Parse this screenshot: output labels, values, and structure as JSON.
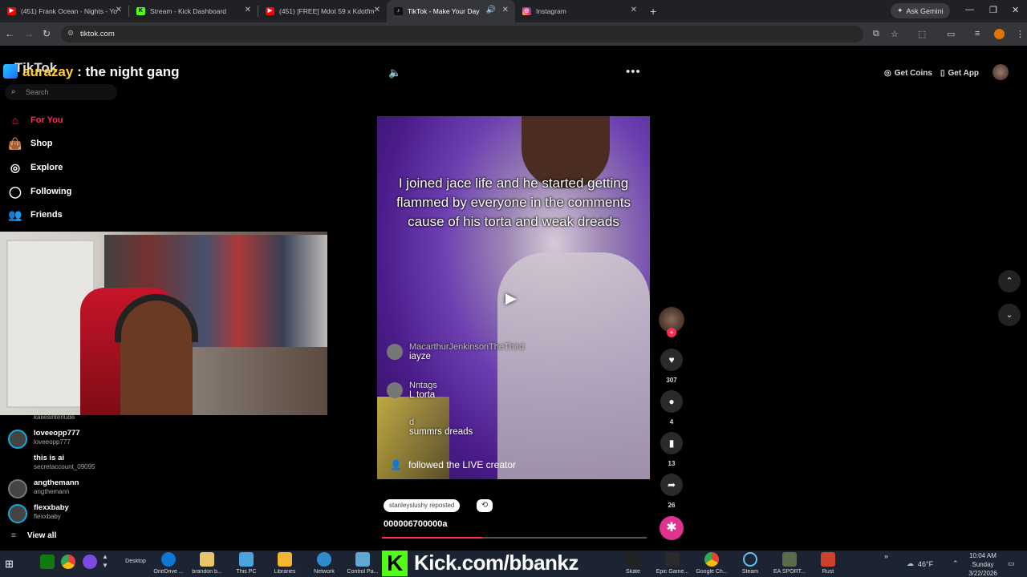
{
  "browser": {
    "tabs": [
      {
        "title": "(451) Frank Ocean - Nights - Yo",
        "icon": "youtube-icon",
        "color": "#ff0000",
        "active": false
      },
      {
        "title": "Stream - Kick Dashboard",
        "icon": "kick-icon",
        "color": "#53fc18",
        "active": false
      },
      {
        "title": "(451) [FREE] Mdot 59 x Kdotfm",
        "icon": "youtube-icon",
        "color": "#ff0000",
        "active": false
      },
      {
        "title": "TikTok - Make Your Day",
        "icon": "tiktok-icon",
        "color": "#000000",
        "active": true
      },
      {
        "title": "Instagram",
        "icon": "instagram-icon",
        "color": "#e1306c",
        "active": false
      }
    ],
    "gemini_label": "Ask Gemini",
    "url": "tiktok.com"
  },
  "tiktok": {
    "logo": "TikTok",
    "overlay_user": "aurazay",
    "overlay_text": ": the night gang",
    "search_placeholder": "Search",
    "nav": [
      {
        "label": "For You",
        "icon": "home-icon",
        "active": true
      },
      {
        "label": "Shop",
        "icon": "shopping-bag-icon",
        "active": false
      },
      {
        "label": "Explore",
        "icon": "compass-icon",
        "active": false
      },
      {
        "label": "Following",
        "icon": "following-icon",
        "active": false
      },
      {
        "label": "Friends",
        "icon": "friends-icon",
        "active": false
      }
    ],
    "following_list": [
      {
        "name": "",
        "username": "kaliesinterlude"
      },
      {
        "name": "loveeopp777",
        "username": "loveeopp777"
      },
      {
        "name": "this is ai",
        "username": "secretaccount_09095"
      },
      {
        "name": "angthemann",
        "username": "angthemann"
      },
      {
        "name": "flexxbaby",
        "username": "flexxbaby"
      }
    ],
    "view_all": "View all",
    "get_coins": "Get Coins",
    "get_app": "Get App",
    "video": {
      "caption": "I joined jace life and he started getting flammed by everyone in the comments cause of his torta and weak dreads",
      "comments": [
        {
          "user": "MacarthurJenkinsonTheThird",
          "text": "iayze"
        },
        {
          "user": "Nntags",
          "text": "L torta"
        },
        {
          "user": "d",
          "text": "summrs dreads"
        }
      ],
      "follow_notice": "followed the LIVE creator",
      "reposted_by": "stanleyslushy reposted",
      "title": "000006700000a",
      "progress": 0.38
    },
    "actions": {
      "likes": "307",
      "comments": "4",
      "saves": "13",
      "shares": "26"
    }
  },
  "taskbar": {
    "items": [
      {
        "label": "Desktop"
      },
      {
        "label": "OneDrive ..."
      },
      {
        "label": "brandon b..."
      },
      {
        "label": "This PC"
      },
      {
        "label": "Libraries"
      },
      {
        "label": "Network"
      },
      {
        "label": "Control Pa..."
      },
      {
        "label": "Skate"
      },
      {
        "label": "Epic Game..."
      },
      {
        "label": "Google Ch..."
      },
      {
        "label": "Steam"
      },
      {
        "label": "EA SPORT..."
      },
      {
        "label": "Rust"
      }
    ],
    "overlay_banner": "Kick.com/bbankz",
    "temperature": "46°F",
    "time": "10:04 AM",
    "day": "Sunday",
    "date": "3/22/2026"
  }
}
